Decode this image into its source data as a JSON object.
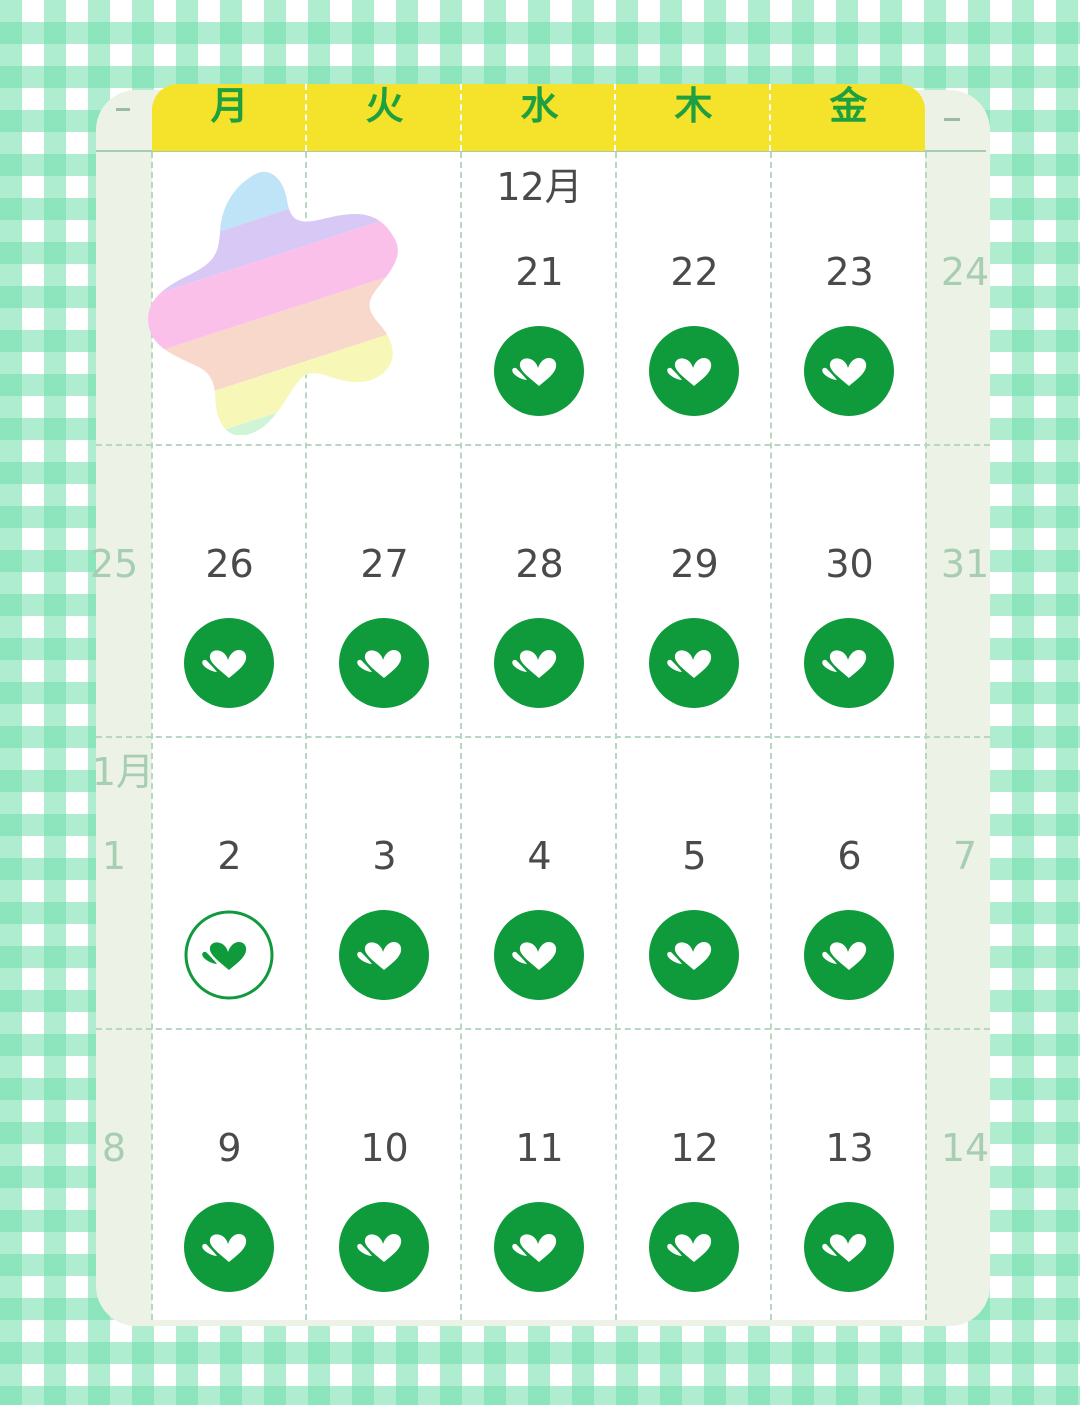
{
  "weekdays": [
    "月",
    "火",
    "水",
    "木",
    "金"
  ],
  "colors": {
    "stamp_green": "#0f9a3c",
    "header_yellow": "#f5e22a",
    "weekday_text": "#1fa040",
    "side_day_text": "#a7cdb3",
    "day_text": "#4a4a4a"
  },
  "months": {
    "december": "12月",
    "january": "1月"
  },
  "sticker": "rainbow-star-sticker",
  "weeks": [
    {
      "sun": "",
      "sat": "24",
      "days": [
        {
          "num": "",
          "stamp": "none"
        },
        {
          "num": "",
          "stamp": "none"
        },
        {
          "num": "21",
          "stamp": "filled"
        },
        {
          "num": "22",
          "stamp": "filled"
        },
        {
          "num": "23",
          "stamp": "filled"
        }
      ]
    },
    {
      "sun": "25",
      "sat": "31",
      "days": [
        {
          "num": "26",
          "stamp": "filled"
        },
        {
          "num": "27",
          "stamp": "filled"
        },
        {
          "num": "28",
          "stamp": "filled"
        },
        {
          "num": "29",
          "stamp": "filled"
        },
        {
          "num": "30",
          "stamp": "filled"
        }
      ]
    },
    {
      "sun": "1",
      "sat": "7",
      "days": [
        {
          "num": "2",
          "stamp": "outline"
        },
        {
          "num": "3",
          "stamp": "filled"
        },
        {
          "num": "4",
          "stamp": "filled"
        },
        {
          "num": "5",
          "stamp": "filled"
        },
        {
          "num": "6",
          "stamp": "filled"
        }
      ]
    },
    {
      "sun": "8",
      "sat": "14",
      "days": [
        {
          "num": "9",
          "stamp": "filled"
        },
        {
          "num": "10",
          "stamp": "filled"
        },
        {
          "num": "11",
          "stamp": "filled"
        },
        {
          "num": "12",
          "stamp": "filled"
        },
        {
          "num": "13",
          "stamp": "filled"
        }
      ]
    }
  ]
}
